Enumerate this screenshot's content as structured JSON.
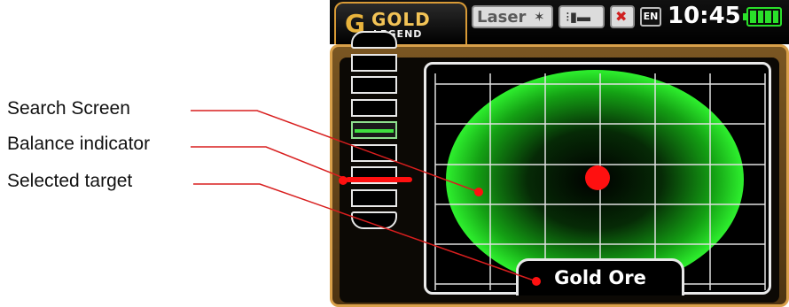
{
  "callouts": {
    "search_screen": "Search Screen",
    "balance_indicator": "Balance indicator",
    "selected_target": "Selected target"
  },
  "device": {
    "brand_word": "GOLD",
    "brand_sub": "LEGEND",
    "mode_badge": "Laser",
    "language": "EN",
    "time": "10:45",
    "battery_level": 1.0,
    "target_name": "Gold Ore",
    "balance_segments": 9,
    "balance_active_segment": 4
  },
  "colors": {
    "frame_gold": "#d9a04a",
    "signal_green": "#2ef02e",
    "marker_red": "#ff1010",
    "callout_line": "#d81e1e"
  },
  "icons": [
    "gold-legend-logo-icon",
    "laser-icon",
    "probe-icon",
    "mute-icon",
    "battery-icon"
  ]
}
